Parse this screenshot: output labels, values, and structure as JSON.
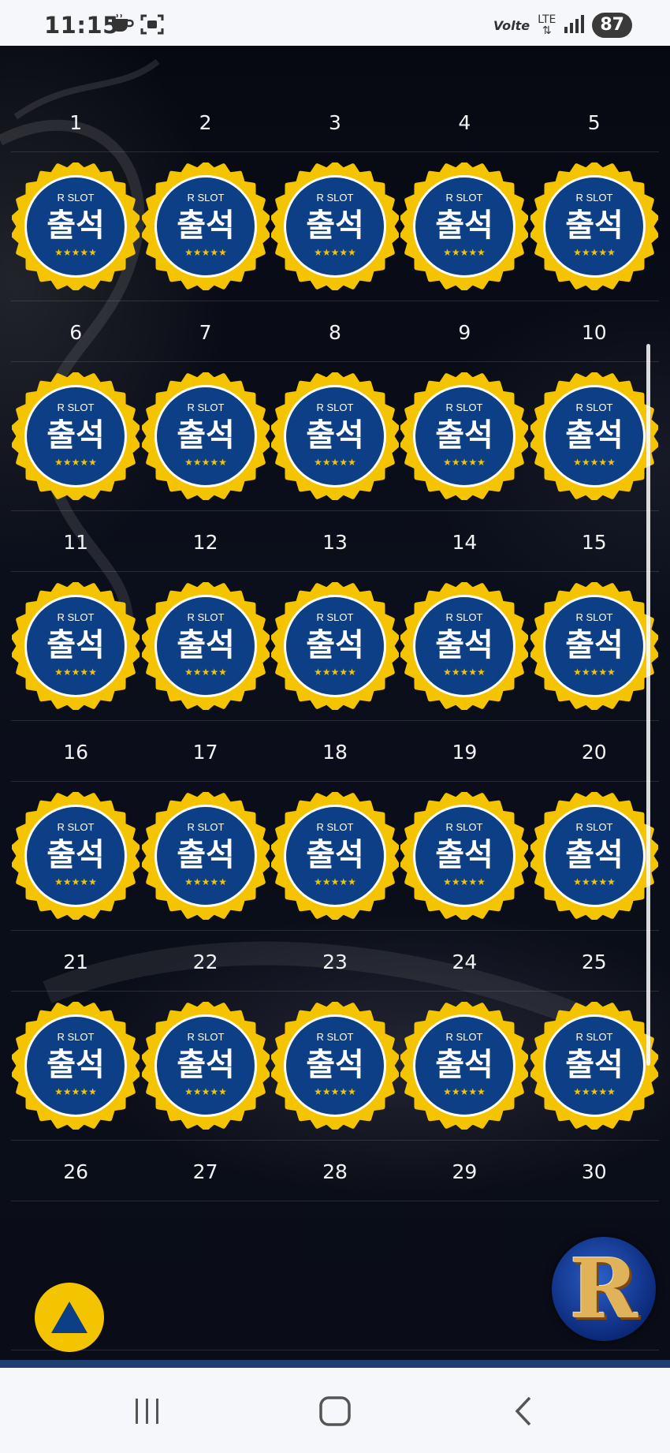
{
  "status_bar": {
    "time": "11:15",
    "volte": "Volte",
    "network": "LTE",
    "battery": "87"
  },
  "badge": {
    "brand": "R SLOT",
    "label": "출석",
    "stars": "★★★★★"
  },
  "days": [
    "1",
    "2",
    "3",
    "4",
    "5",
    "6",
    "7",
    "8",
    "9",
    "10",
    "11",
    "12",
    "13",
    "14",
    "15",
    "16",
    "17",
    "18",
    "19",
    "20",
    "21",
    "22",
    "23",
    "24",
    "25",
    "26",
    "27",
    "28",
    "29",
    "30"
  ],
  "attended_days": 25,
  "logo_letter": "R",
  "colors": {
    "badge_gold": "#f5c400",
    "badge_blue": "#0d3f86",
    "background": "#0b0f1a",
    "scroll_top_button": "#f5c400"
  },
  "icons": {
    "scroll_top": "triangle-up-icon",
    "nav_recent": "recent-apps-icon",
    "nav_home": "home-icon",
    "nav_back": "back-icon"
  }
}
